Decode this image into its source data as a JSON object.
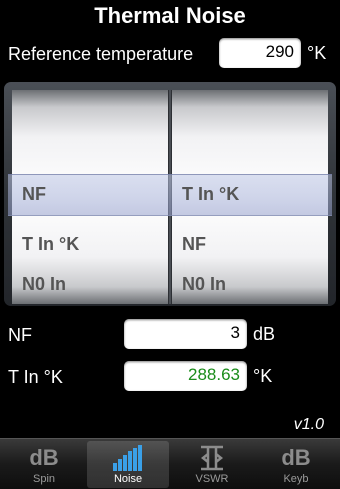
{
  "title": "Thermal Noise",
  "reference": {
    "label": "Reference temperature",
    "value": "290",
    "unit": "°K"
  },
  "picker": {
    "left_selected": "NF",
    "left_below": "T In °K",
    "left_below2": "N0 In",
    "right_selected": "T In °K",
    "right_below": "NF",
    "right_below2": "N0 In"
  },
  "results": {
    "nf_label": "NF",
    "nf_value": "3",
    "nf_unit": "dB",
    "tin_label": "T In °K",
    "tin_value": "288.63",
    "tin_unit": "°K"
  },
  "version": "v1.0",
  "tabs": [
    {
      "icon": "dB",
      "label": "Spin"
    },
    {
      "icon": "",
      "label": "Noise"
    },
    {
      "icon": "",
      "label": "VSWR"
    },
    {
      "icon": "dB",
      "label": "Keyb"
    }
  ],
  "colors": {
    "computed_value": "#1a8c1a"
  }
}
